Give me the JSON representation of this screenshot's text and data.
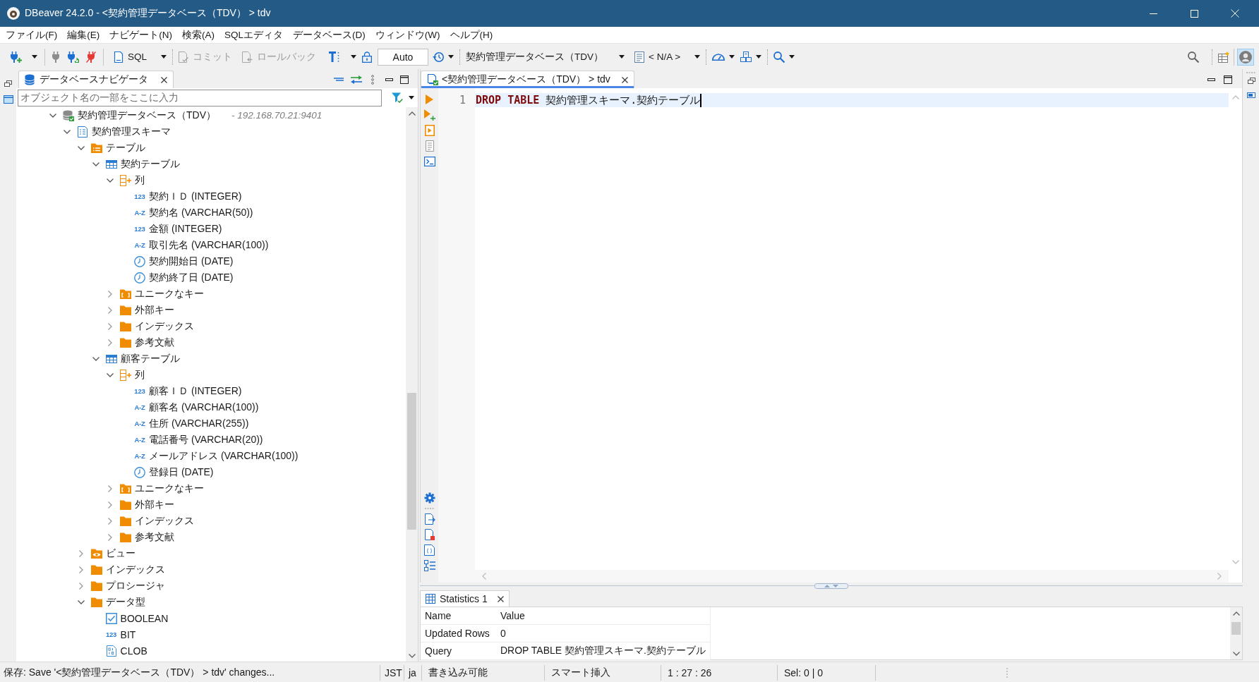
{
  "window": {
    "title": "DBeaver 24.2.0 - <契約管理データベース（TDV） > tdv"
  },
  "menu": [
    "ファイル(F)",
    "編集(E)",
    "ナビゲート(N)",
    "検索(A)",
    "SQLエディタ",
    "データベース(D)",
    "ウィンドウ(W)",
    "ヘルプ(H)"
  ],
  "toolbar": {
    "sql_button": {
      "label": "SQL"
    },
    "commit_button": {
      "label": "コミット",
      "disabled": true
    },
    "rollback_button": {
      "label": "ロールバック",
      "disabled": true
    },
    "transaction_mode": {
      "label": "Auto"
    },
    "datasource": {
      "label": "契約管理データベース（TDV）"
    },
    "schema": {
      "label": "< N/A >"
    }
  },
  "navigator": {
    "tab": {
      "label": "データベースナビゲータ",
      "selected": true
    },
    "filter": {
      "placeholder": "オブジェクト名の一部をここに入力"
    },
    "tree": [
      {
        "label": "契約管理データベース（TDV）",
        "detail": "- 192.168.70.21:9401",
        "kind": "database",
        "connected": true,
        "expanded": true,
        "children": [
          {
            "label": "契約管理スキーマ",
            "kind": "schema",
            "expanded": true,
            "children": [
              {
                "label": "テーブル",
                "kind": "tables",
                "expanded": true,
                "children": [
                  {
                    "label": "契約テーブル",
                    "kind": "table",
                    "expanded": true,
                    "children": [
                      {
                        "label": "列",
                        "kind": "columns",
                        "expanded": true,
                        "children": [
                          {
                            "label": "契約ＩＤ (INTEGER)",
                            "kind": "numeric",
                            "glyph": "123"
                          },
                          {
                            "label": "契約名 (VARCHAR(50))",
                            "kind": "text",
                            "glyph": "A-Z"
                          },
                          {
                            "label": "金額 (INTEGER)",
                            "kind": "numeric",
                            "glyph": "123"
                          },
                          {
                            "label": "取引先名 (VARCHAR(100))",
                            "kind": "text",
                            "glyph": "A-Z"
                          },
                          {
                            "label": "契約開始日 (DATE)",
                            "kind": "date"
                          },
                          {
                            "label": "契約終了日 (DATE)",
                            "kind": "date"
                          }
                        ]
                      },
                      {
                        "label": "ユニークなキー",
                        "kind": "keys",
                        "expanded": false
                      },
                      {
                        "label": "外部キー",
                        "kind": "folder",
                        "expanded": false
                      },
                      {
                        "label": "インデックス",
                        "kind": "folder",
                        "expanded": false
                      },
                      {
                        "label": "参考文献",
                        "kind": "folder",
                        "expanded": false
                      }
                    ]
                  },
                  {
                    "label": "顧客テーブル",
                    "kind": "table",
                    "expanded": true,
                    "children": [
                      {
                        "label": "列",
                        "kind": "columns",
                        "expanded": true,
                        "children": [
                          {
                            "label": "顧客ＩＤ (INTEGER)",
                            "kind": "numeric",
                            "glyph": "123"
                          },
                          {
                            "label": "顧客名 (VARCHAR(100))",
                            "kind": "text",
                            "glyph": "A-Z"
                          },
                          {
                            "label": "住所 (VARCHAR(255))",
                            "kind": "text",
                            "glyph": "A-Z"
                          },
                          {
                            "label": "電話番号 (VARCHAR(20))",
                            "kind": "text",
                            "glyph": "A-Z"
                          },
                          {
                            "label": "メールアドレス (VARCHAR(100))",
                            "kind": "text",
                            "glyph": "A-Z"
                          },
                          {
                            "label": "登録日 (DATE)",
                            "kind": "date"
                          }
                        ]
                      },
                      {
                        "label": "ユニークなキー",
                        "kind": "keys",
                        "expanded": false
                      },
                      {
                        "label": "外部キー",
                        "kind": "folder",
                        "expanded": false
                      },
                      {
                        "label": "インデックス",
                        "kind": "folder",
                        "expanded": false
                      },
                      {
                        "label": "参考文献",
                        "kind": "folder",
                        "expanded": false
                      }
                    ]
                  }
                ]
              },
              {
                "label": "ビュー",
                "kind": "views",
                "expanded": false
              },
              {
                "label": "インデックス",
                "kind": "folder",
                "expanded": false
              },
              {
                "label": "プロシージャ",
                "kind": "folder",
                "expanded": false
              },
              {
                "label": "データ型",
                "kind": "folder",
                "expanded": true,
                "children": [
                  {
                    "label": "BOOLEAN",
                    "kind": "boolean"
                  },
                  {
                    "label": "BIT",
                    "kind": "numeric",
                    "glyph": "123"
                  },
                  {
                    "label": "CLOB",
                    "kind": "clob"
                  }
                ]
              }
            ]
          }
        ]
      }
    ]
  },
  "editor": {
    "tab": {
      "label": "<契約管理データベース（TDV） > tdv",
      "selected": true,
      "connected": true
    },
    "lines": [
      {
        "number": "1",
        "current": true,
        "tokens": [
          {
            "kind": "keyword",
            "text": "DROP TABLE"
          },
          {
            "kind": "plain",
            "text": " 契約管理スキーマ.契約テーブル"
          }
        ]
      }
    ]
  },
  "statistics": {
    "tab": {
      "label": "Statistics 1",
      "selected": true
    },
    "columns": [
      "Name",
      "Value"
    ],
    "rows": [
      [
        "Updated Rows",
        "0"
      ],
      [
        "Query",
        "DROP TABLE 契約管理スキーマ.契約テーブル"
      ]
    ]
  },
  "status_bar": {
    "message": "保存: Save '<契約管理データベース（TDV） > tdv' changes...",
    "fields": [
      "JST",
      "ja",
      "書き込み可能",
      "スマート挿入",
      "1 : 27 : 26",
      "Sel: 0 | 0"
    ]
  }
}
